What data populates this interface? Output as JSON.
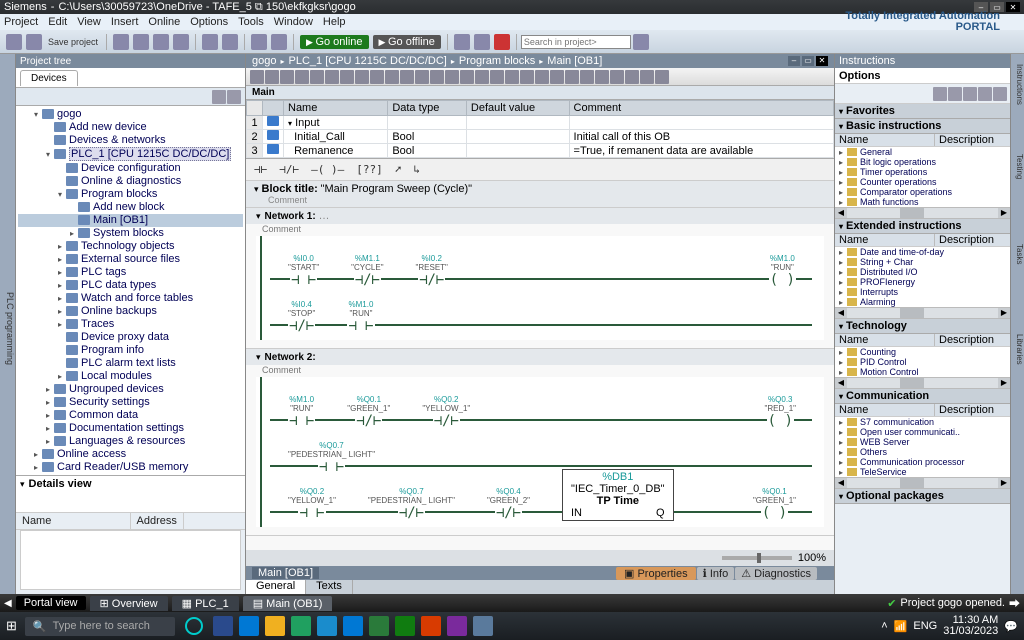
{
  "titlebar": {
    "appname": "Siemens",
    "path": "C:\\Users\\30059723\\OneDrive - TAFE_5 ⧉ 150\\ekfkgksr\\gogo"
  },
  "menu": [
    "Project",
    "Edit",
    "View",
    "Insert",
    "Online",
    "Options",
    "Tools",
    "Window",
    "Help"
  ],
  "brand": {
    "line1": "Totally Integrated Automation",
    "line2": "PORTAL"
  },
  "toolbar": {
    "save": "Save project",
    "goonline": "Go online",
    "gooffline": "Go offline",
    "search_ph": "Search in project>"
  },
  "project_tree": {
    "title": "Project tree",
    "tab": "Devices",
    "nodes": [
      {
        "lbl": "gogo",
        "lvl": 1,
        "exp": "▾"
      },
      {
        "lbl": "Add new device",
        "lvl": 2
      },
      {
        "lbl": "Devices & networks",
        "lvl": 2
      },
      {
        "lbl": "PLC_1 [CPU 1215C DC/DC/DC]",
        "lvl": 2,
        "exp": "▾",
        "hl": true
      },
      {
        "lbl": "Device configuration",
        "lvl": 3
      },
      {
        "lbl": "Online & diagnostics",
        "lvl": 3
      },
      {
        "lbl": "Program blocks",
        "lvl": 3,
        "exp": "▾"
      },
      {
        "lbl": "Add new block",
        "lvl": 4
      },
      {
        "lbl": "Main [OB1]",
        "lvl": 4,
        "sel": true
      },
      {
        "lbl": "System blocks",
        "lvl": 4,
        "exp": "▸"
      },
      {
        "lbl": "Technology objects",
        "lvl": 3,
        "exp": "▸"
      },
      {
        "lbl": "External source files",
        "lvl": 3,
        "exp": "▸"
      },
      {
        "lbl": "PLC tags",
        "lvl": 3,
        "exp": "▸"
      },
      {
        "lbl": "PLC data types",
        "lvl": 3,
        "exp": "▸"
      },
      {
        "lbl": "Watch and force tables",
        "lvl": 3,
        "exp": "▸"
      },
      {
        "lbl": "Online backups",
        "lvl": 3,
        "exp": "▸"
      },
      {
        "lbl": "Traces",
        "lvl": 3,
        "exp": "▸"
      },
      {
        "lbl": "Device proxy data",
        "lvl": 3
      },
      {
        "lbl": "Program info",
        "lvl": 3
      },
      {
        "lbl": "PLC alarm text lists",
        "lvl": 3
      },
      {
        "lbl": "Local modules",
        "lvl": 3,
        "exp": "▸"
      },
      {
        "lbl": "Ungrouped devices",
        "lvl": 2,
        "exp": "▸"
      },
      {
        "lbl": "Security settings",
        "lvl": 2,
        "exp": "▸"
      },
      {
        "lbl": "Common data",
        "lvl": 2,
        "exp": "▸"
      },
      {
        "lbl": "Documentation settings",
        "lvl": 2,
        "exp": "▸"
      },
      {
        "lbl": "Languages & resources",
        "lvl": 2,
        "exp": "▸"
      },
      {
        "lbl": "Online access",
        "lvl": 1,
        "exp": "▸"
      },
      {
        "lbl": "Card Reader/USB memory",
        "lvl": 1,
        "exp": "▸"
      }
    ],
    "details": {
      "title": "Details view",
      "col1": "Name",
      "col2": "Address"
    }
  },
  "breadcrumb": [
    "gogo",
    "PLC_1 [CPU 1215C DC/DC/DC]",
    "Program blocks",
    "Main [OB1]"
  ],
  "main_label": "Main",
  "iface": {
    "headers": [
      "Name",
      "Data type",
      "Default value",
      "Comment"
    ],
    "rows": [
      {
        "n": "1",
        "name": "Input",
        "dt": "",
        "dv": "",
        "cm": "",
        "exp": "▾"
      },
      {
        "n": "2",
        "name": "Initial_Call",
        "dt": "Bool",
        "dv": "",
        "cm": "Initial call of this OB"
      },
      {
        "n": "3",
        "name": "Remanence",
        "dt": "Bool",
        "dv": "",
        "cm": "=True, if remanent data are available"
      }
    ]
  },
  "ladder_symbols": [
    "⊣⊢",
    "⊣/⊢",
    "–( )–",
    "[??]",
    "➚",
    "↳"
  ],
  "block_title": {
    "label": "Block title:",
    "value": "\"Main Program Sweep (Cycle)\"",
    "comment": "Comment"
  },
  "networks": [
    {
      "title": "Network 1:",
      "dots": "…",
      "comment": "Comment",
      "rows": [
        [
          {
            "addr": "%I0.0",
            "tag": "\"START\"",
            "sym": "⊣ ⊢"
          },
          {
            "addr": "%M1.1",
            "tag": "\"CYCLE\"",
            "sym": "⊣/⊢"
          },
          {
            "addr": "%I0.2",
            "tag": "\"RESET\"",
            "sym": "⊣/⊢"
          },
          {
            "addr": "%M1.0",
            "tag": "\"RUN\"",
            "sym": "( )",
            "right": true
          }
        ],
        [
          {
            "addr": "%I0.4",
            "tag": "\"STOP\"",
            "sym": "⊣/⊢"
          },
          {
            "addr": "%M1.0",
            "tag": "\"RUN\"",
            "sym": "⊣ ⊢"
          }
        ]
      ]
    },
    {
      "title": "Network 2:",
      "comment": "Comment",
      "rows": [
        [
          {
            "addr": "%M1.0",
            "tag": "\"RUN\"",
            "sym": "⊣ ⊢"
          },
          {
            "addr": "%Q0.1",
            "tag": "\"GREEN_1\"",
            "sym": "⊣/⊢"
          },
          {
            "addr": "%Q0.2",
            "tag": "\"YELLOW_1\"",
            "sym": "⊣/⊢"
          },
          {
            "addr": "%Q0.3",
            "tag": "\"RED_1\"",
            "sym": "( )",
            "right": true
          }
        ],
        [
          {
            "addr": "%Q0.7",
            "tag": "\"PEDESTRIAN_ LIGHT\"",
            "sym": "⊣ ⊢"
          }
        ],
        [
          {
            "addr": "%Q0.2",
            "tag": "\"YELLOW_1\"",
            "sym": "⊣ ⊢"
          },
          {
            "addr": "%Q0.7",
            "tag": "\"PEDESTRIAN_ LIGHT\"",
            "sym": "⊣/⊢"
          },
          {
            "addr": "%Q0.4",
            "tag": "\"GREEN_2\"",
            "sym": "⊣/⊢"
          },
          {
            "type": "box",
            "name": "%DB1",
            "sub": "\"IEC_Timer_0_DB\"",
            "label": "TP Time",
            "in": "IN",
            "out": "Q"
          },
          {
            "addr": "%Q0.1",
            "tag": "\"GREEN_1\"",
            "sym": "( )",
            "right": true
          }
        ]
      ]
    }
  ],
  "zoom": "100%",
  "cfoot": {
    "title": "Main [OB1]",
    "props": "Properties",
    "info": "Info",
    "diag": "Diagnostics"
  },
  "subtabs": [
    "General",
    "Texts"
  ],
  "instructions": {
    "title": "Instructions",
    "options": "Options",
    "sections": [
      {
        "title": "Favorites",
        "col1": "",
        "col2": "",
        "items": []
      },
      {
        "title": "Basic instructions",
        "col1": "Name",
        "col2": "Description",
        "items": [
          "General",
          "Bit logic operations",
          "Timer operations",
          "Counter operations",
          "Comparator operations",
          "Math functions"
        ],
        "scroll": true
      },
      {
        "title": "Extended instructions",
        "col1": "Name",
        "col2": "Description",
        "items": [
          "Date and time-of-day",
          "String + Char",
          "Distributed I/O",
          "PROFIenergy",
          "Interrupts",
          "Alarming"
        ],
        "scroll": true
      },
      {
        "title": "Technology",
        "col1": "Name",
        "col2": "Description",
        "items": [
          "Counting",
          "PID Control",
          "Motion Control"
        ],
        "bottomscroll": true
      },
      {
        "title": "Communication",
        "col1": "Name",
        "col2": "Description",
        "items": [
          "S7 communication",
          "Open user communicati..",
          "WEB Server",
          "Others",
          "Communication processor",
          "TeleService"
        ],
        "bottomscroll": true
      },
      {
        "title": "Optional packages",
        "items": []
      }
    ]
  },
  "rside": [
    "Instructions",
    "Testing",
    "Tasks",
    "Libraries"
  ],
  "gfoot": {
    "portal": "Portal view",
    "overview": "Overview",
    "plc": "PLC_1",
    "main": "Main (OB1)",
    "status": "Project gogo opened."
  },
  "taskbar": {
    "search_ph": "Type here to search",
    "apps": [
      "#2a4a8c",
      "#0078d4",
      "#f0b020",
      "#20a060",
      "#1a8ccc",
      "#0078d4",
      "#2a7a3a",
      "#107c10",
      "#d83b01",
      "#7a2a9c",
      "#5a7a9c"
    ],
    "tray": {
      "lang": "ENG",
      "time": "11:30 AM",
      "date": "31/03/2023",
      "arrow": "˄",
      "net": "📶"
    }
  }
}
